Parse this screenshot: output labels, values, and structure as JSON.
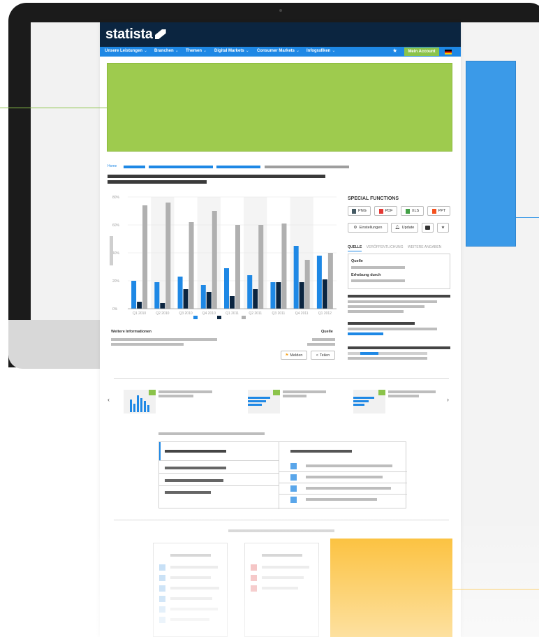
{
  "header": {
    "logo_text": "statista"
  },
  "nav": {
    "items": [
      {
        "label": "Unsere Leistungen"
      },
      {
        "label": "Branchen"
      },
      {
        "label": "Themen"
      },
      {
        "label": "Digital Markets"
      },
      {
        "label": "Consumer Markets"
      },
      {
        "label": "Infografiken"
      }
    ],
    "account_label": "Mein Account"
  },
  "breadcrumb": {
    "home": "Home"
  },
  "chart_data": {
    "type": "bar",
    "categories": [
      "Q1 2010",
      "Q2 2010",
      "Q3 2010",
      "Q4 2010",
      "Q1 2011",
      "Q2 2011",
      "Q3 2011",
      "Q4 2011",
      "Q1 2012"
    ],
    "series": [
      {
        "values": [
          20,
          19,
          23,
          17,
          29,
          24,
          19,
          45,
          38
        ]
      },
      {
        "values": [
          5,
          4,
          14,
          12,
          9,
          14,
          19,
          19,
          21
        ]
      },
      {
        "values": [
          74,
          76,
          62,
          70,
          60,
          60,
          61,
          35,
          40
        ]
      }
    ],
    "yticks": [
      "0%",
      "20%",
      "40%",
      "60%",
      "80%"
    ],
    "ylim": [
      0,
      80
    ],
    "colors": [
      "#1e88e5",
      "#0b2540",
      "#b0b0b0"
    ]
  },
  "side": {
    "title": "SPECIAL FUNCTIONS",
    "downloads": [
      "PNG",
      "PDF",
      "XLS",
      "PPT"
    ],
    "settings_label": "Einstellungen",
    "update_label": "Update",
    "tabs": [
      "QUELLE",
      "VERÖFFENTLICHUNG",
      "WEITERE ANGABEN"
    ],
    "source_label": "Quelle",
    "survey_label": "Erhebung durch"
  },
  "info": {
    "weitere_label": "Weitere Informationen",
    "quelle_label": "Quelle",
    "report_label": "Melden",
    "share_label": "Teilen"
  },
  "colors": {
    "navy": "#0b2540",
    "blue": "#1e88e5",
    "green": "#9ecb4e",
    "yellow": "#fbbc2d"
  }
}
